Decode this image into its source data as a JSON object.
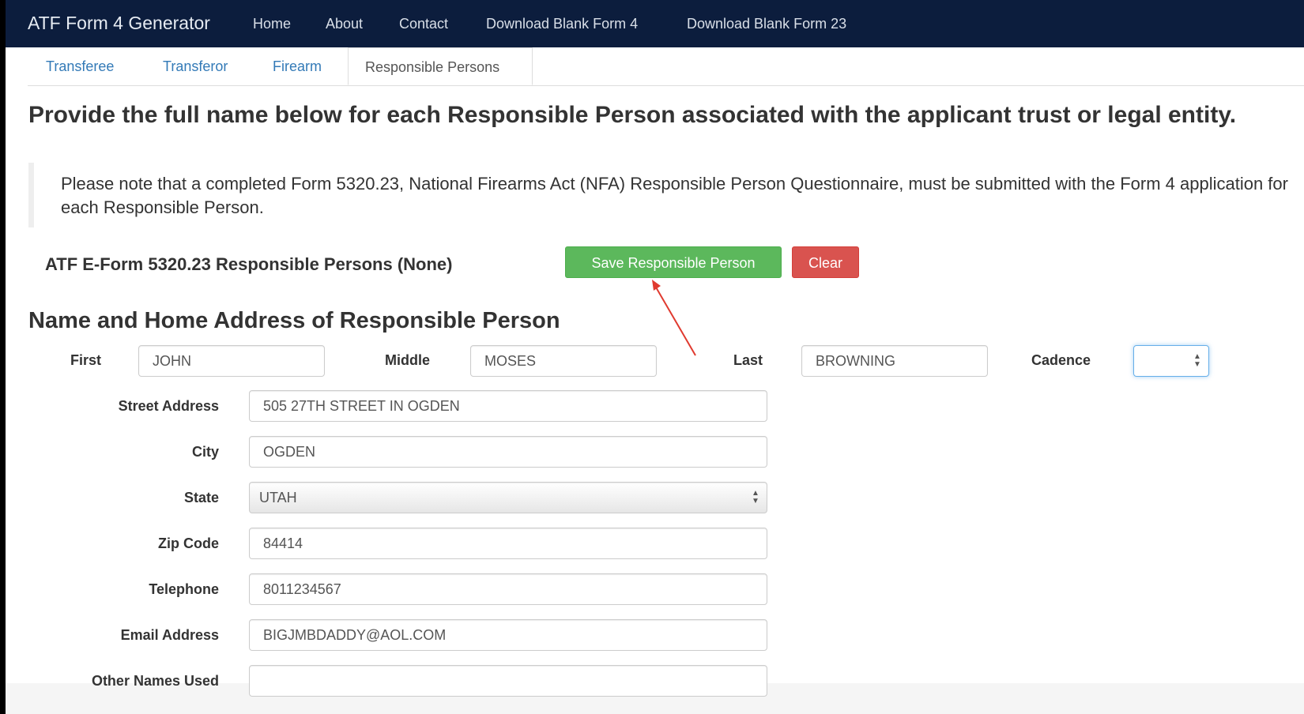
{
  "navbar": {
    "brand": "ATF Form 4 Generator",
    "links": [
      "Home",
      "About",
      "Contact",
      "Download Blank Form 4",
      "Download Blank Form 23"
    ]
  },
  "tabs": {
    "items": [
      "Transferee",
      "Transferor",
      "Firearm"
    ],
    "active": "Responsible Persons"
  },
  "heading": "Provide the full name below for each Responsible Person associated with the applicant trust or legal entity.",
  "note": "Please note that a completed Form 5320.23, National Firearms Act (NFA) Responsible Person Questionnaire, must be submitted with the Form 4 application for each Responsible Person.",
  "rp_status": "ATF E-Form 5320.23 Responsible Persons (None)",
  "buttons": {
    "save": "Save Responsible Person",
    "clear": "Clear"
  },
  "subheading": "Name and Home Address of Responsible Person",
  "form": {
    "first_label": "First",
    "first_value": "JOHN",
    "middle_label": "Middle",
    "middle_value": "MOSES",
    "last_label": "Last",
    "last_value": "BROWNING",
    "cadence_label": "Cadence",
    "cadence_value": "",
    "street_label": "Street Address",
    "street_value": "505 27TH STREET IN OGDEN",
    "city_label": "City",
    "city_value": "OGDEN",
    "state_label": "State",
    "state_value": "UTAH",
    "zip_label": "Zip Code",
    "zip_value": "84414",
    "phone_label": "Telephone",
    "phone_value": "8011234567",
    "email_label": "Email Address",
    "email_value": "BIGJMBDADDY@AOL.COM",
    "other_label": "Other Names Used",
    "other_value": ""
  },
  "colors": {
    "navbar_bg": "#0c1d3d",
    "tab_link": "#337ab7",
    "save_button": "#5cb85c",
    "clear_button": "#d9534f",
    "annotation_arrow": "#e03a2f"
  }
}
